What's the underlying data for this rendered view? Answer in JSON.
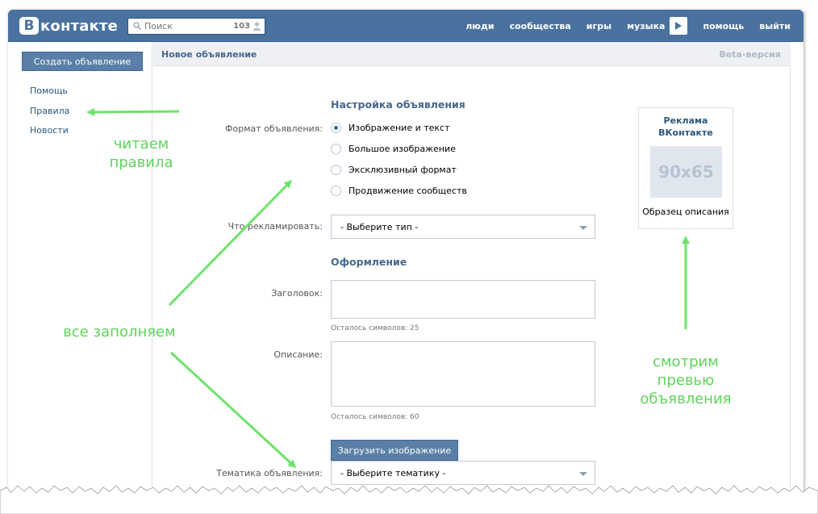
{
  "header": {
    "logo_letter": "В",
    "logo_text": "контакте",
    "search_placeholder": "Поиск",
    "search_count": "103",
    "nav": [
      "люди",
      "сообщества",
      "игры",
      "музыка",
      "помощь",
      "выйти"
    ]
  },
  "sidebar": {
    "create_button": "Создать объявление",
    "links": [
      "Помощь",
      "Правила",
      "Новости"
    ]
  },
  "main": {
    "title": "Новое объявление",
    "beta": "Beta-версия",
    "setup_section": "Настройка объявления",
    "format_label": "Формат объявления:",
    "formats": [
      {
        "label": "Изображение и текст",
        "selected": true
      },
      {
        "label": "Большое изображение",
        "selected": false
      },
      {
        "label": "Эксклюзивный формат",
        "selected": false
      },
      {
        "label": "Продвижение сообществ",
        "selected": false
      }
    ],
    "advertise_label": "Что рекламировать:",
    "advertise_value": "- Выберите тип -",
    "design_section": "Оформление",
    "title_label": "Заголовок:",
    "title_hint": "Осталось символов: 25",
    "description_label": "Описание:",
    "description_hint": "Осталось символов: 60",
    "upload_button": "Загрузить изображение",
    "topic_label": "Тематика объявления:",
    "topic_value": "- Выберите тематику -"
  },
  "preview": {
    "title_line1": "Реклама",
    "title_line2": "ВКонтакте",
    "image_placeholder": "90x65",
    "description": "Образец описания"
  },
  "annotations": {
    "read_rules": [
      "читаем",
      "правила"
    ],
    "fill_all": "все заполняем",
    "preview_note": [
      "смотрим",
      "превью",
      "объявления"
    ],
    "color": "#5ed45a"
  }
}
